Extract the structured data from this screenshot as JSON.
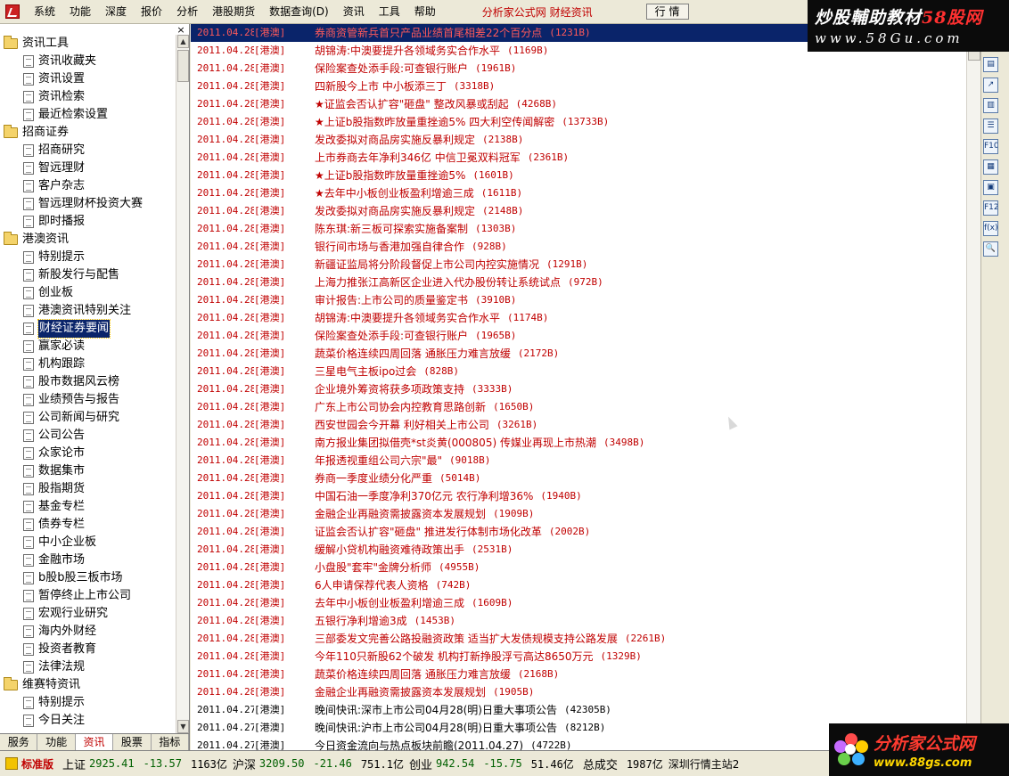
{
  "menubar": {
    "items": [
      "系统",
      "功能",
      "深度",
      "报价",
      "分析",
      "港股期货",
      "数据查询(D)",
      "资讯",
      "工具",
      "帮助"
    ],
    "brand": "分析家公式网 财经资讯",
    "market_button": "行 情"
  },
  "watermark_top": {
    "line1_part1": "炒股輔助教材",
    "line1_part2": "58股网",
    "line2": "www.58Gu.com"
  },
  "sidebar": {
    "close_label": "×",
    "tree": [
      {
        "type": "folder",
        "label": "资讯工具"
      },
      {
        "type": "leaf",
        "label": "资讯收藏夹"
      },
      {
        "type": "leaf",
        "label": "资讯设置"
      },
      {
        "type": "leaf",
        "label": "资讯检索"
      },
      {
        "type": "leaf",
        "label": "最近检索设置"
      },
      {
        "type": "folder",
        "label": "招商证券"
      },
      {
        "type": "leaf",
        "label": "招商研究"
      },
      {
        "type": "leaf",
        "label": "智远理财"
      },
      {
        "type": "leaf",
        "label": "客户杂志"
      },
      {
        "type": "leaf",
        "label": "智远理财杯投资大赛"
      },
      {
        "type": "leaf",
        "label": "即时播报"
      },
      {
        "type": "folder",
        "label": "港澳资讯"
      },
      {
        "type": "leaf",
        "label": "特别提示"
      },
      {
        "type": "leaf",
        "label": "新股发行与配售"
      },
      {
        "type": "leaf",
        "label": "创业板"
      },
      {
        "type": "leaf",
        "label": "港澳资讯特别关注"
      },
      {
        "type": "leaf",
        "label": "财经证券要闻",
        "selected": true
      },
      {
        "type": "leaf",
        "label": "赢家必读"
      },
      {
        "type": "leaf",
        "label": "机构跟踪"
      },
      {
        "type": "leaf",
        "label": "股市数据风云榜"
      },
      {
        "type": "leaf",
        "label": "业绩预告与报告"
      },
      {
        "type": "leaf",
        "label": "公司新闻与研究"
      },
      {
        "type": "leaf",
        "label": "公司公告"
      },
      {
        "type": "leaf",
        "label": "众家论市"
      },
      {
        "type": "leaf",
        "label": "数据集市"
      },
      {
        "type": "leaf",
        "label": "股指期货"
      },
      {
        "type": "leaf",
        "label": "基金专栏"
      },
      {
        "type": "leaf",
        "label": "债券专栏"
      },
      {
        "type": "leaf",
        "label": "中小企业板"
      },
      {
        "type": "leaf",
        "label": "金融市场"
      },
      {
        "type": "leaf",
        "label": "b股b股三板市场"
      },
      {
        "type": "leaf",
        "label": "暂停终止上市公司"
      },
      {
        "type": "leaf",
        "label": "宏观行业研究"
      },
      {
        "type": "leaf",
        "label": "海内外财经"
      },
      {
        "type": "leaf",
        "label": "投资者教育"
      },
      {
        "type": "leaf",
        "label": "法律法规"
      },
      {
        "type": "folder",
        "label": "维赛特资讯"
      },
      {
        "type": "leaf",
        "label": "特别提示"
      },
      {
        "type": "leaf",
        "label": "今日关注"
      }
    ],
    "tabs": [
      {
        "label": "服务",
        "active": false
      },
      {
        "label": "功能",
        "active": false
      },
      {
        "label": "资讯",
        "active": true
      },
      {
        "label": "股票",
        "active": false
      },
      {
        "label": "指标",
        "active": false
      }
    ]
  },
  "news": [
    {
      "date": "2011.04.28",
      "src": "[港澳]",
      "title": "券商资管新兵首只产品业绩首尾相差22个百分点",
      "size": "(1231B)",
      "style": "highlight"
    },
    {
      "date": "2011.04.28",
      "src": "[港澳]",
      "title": "胡锦涛:中澳要提升各领域务实合作水平",
      "size": "(1169B)",
      "style": "red"
    },
    {
      "date": "2011.04.28",
      "src": "[港澳]",
      "title": "保险案查处添手段:可查银行账户",
      "size": "(1961B)",
      "style": "red"
    },
    {
      "date": "2011.04.28",
      "src": "[港澳]",
      "title": "四新股今上市 中小板添三丁",
      "size": "(3318B)",
      "style": "red"
    },
    {
      "date": "2011.04.28",
      "src": "[港澳]",
      "title": "★证监会否认扩容\"砸盘\" 整改风暴或刮起",
      "size": "(4268B)",
      "style": "red"
    },
    {
      "date": "2011.04.28",
      "src": "[港澳]",
      "title": "★上证b股指数昨放量重挫逾5% 四大利空传闻解密",
      "size": "(13733B)",
      "style": "red"
    },
    {
      "date": "2011.04.28",
      "src": "[港澳]",
      "title": "发改委拟对商品房实施反暴利规定",
      "size": "(2138B)",
      "style": "red"
    },
    {
      "date": "2011.04.28",
      "src": "[港澳]",
      "title": "上市券商去年净利346亿 中信卫冕双料冠军",
      "size": "(2361B)",
      "style": "red"
    },
    {
      "date": "2011.04.28",
      "src": "[港澳]",
      "title": "★上证b股指数昨放量重挫逾5%",
      "size": "(1601B)",
      "style": "red"
    },
    {
      "date": "2011.04.28",
      "src": "[港澳]",
      "title": "★去年中小板创业板盈利增逾三成",
      "size": "(1611B)",
      "style": "red"
    },
    {
      "date": "2011.04.28",
      "src": "[港澳]",
      "title": "发改委拟对商品房实施反暴利规定",
      "size": "(2148B)",
      "style": "red"
    },
    {
      "date": "2011.04.28",
      "src": "[港澳]",
      "title": "陈东琪:新三板可探索实施备案制",
      "size": "(1303B)",
      "style": "red"
    },
    {
      "date": "2011.04.28",
      "src": "[港澳]",
      "title": "银行间市场与香港加强自律合作",
      "size": "(928B)",
      "style": "red"
    },
    {
      "date": "2011.04.28",
      "src": "[港澳]",
      "title": "新疆证监局将分阶段督促上市公司内控实施情况",
      "size": "(1291B)",
      "style": "red"
    },
    {
      "date": "2011.04.28",
      "src": "[港澳]",
      "title": "上海力推张江高新区企业进入代办股份转让系统试点",
      "size": "(972B)",
      "style": "red"
    },
    {
      "date": "2011.04.28",
      "src": "[港澳]",
      "title": "审计报告:上市公司的质量鉴定书",
      "size": "(3910B)",
      "style": "red"
    },
    {
      "date": "2011.04.28",
      "src": "[港澳]",
      "title": "胡锦涛:中澳要提升各领域务实合作水平",
      "size": "(1174B)",
      "style": "red"
    },
    {
      "date": "2011.04.28",
      "src": "[港澳]",
      "title": "保险案查处添手段:可查银行账户",
      "size": "(1965B)",
      "style": "red"
    },
    {
      "date": "2011.04.28",
      "src": "[港澳]",
      "title": "蔬菜价格连续四周回落 通胀压力难言放缓",
      "size": "(2172B)",
      "style": "red"
    },
    {
      "date": "2011.04.28",
      "src": "[港澳]",
      "title": "三星电气主板ipo过会",
      "size": "(828B)",
      "style": "red"
    },
    {
      "date": "2011.04.28",
      "src": "[港澳]",
      "title": "企业境外筹资将获多项政策支持",
      "size": "(3333B)",
      "style": "red"
    },
    {
      "date": "2011.04.28",
      "src": "[港澳]",
      "title": "广东上市公司协会内控教育思路创新",
      "size": "(1650B)",
      "style": "red"
    },
    {
      "date": "2011.04.28",
      "src": "[港澳]",
      "title": "西安世园会今开幕 利好相关上市公司",
      "size": "(3261B)",
      "style": "red"
    },
    {
      "date": "2011.04.28",
      "src": "[港澳]",
      "title": "南方报业集团拟借壳*st炎黄(000805) 传媒业再现上市热潮",
      "size": "(3498B)",
      "style": "red"
    },
    {
      "date": "2011.04.28",
      "src": "[港澳]",
      "title": "年报透视重组公司六宗\"最\"",
      "size": "(9018B)",
      "style": "red"
    },
    {
      "date": "2011.04.28",
      "src": "[港澳]",
      "title": "券商一季度业绩分化严重",
      "size": "(5014B)",
      "style": "red"
    },
    {
      "date": "2011.04.28",
      "src": "[港澳]",
      "title": "中国石油一季度净利370亿元 农行净利增36%",
      "size": "(1940B)",
      "style": "red"
    },
    {
      "date": "2011.04.28",
      "src": "[港澳]",
      "title": "金融企业再融资需披露资本发展规划",
      "size": "(1909B)",
      "style": "red"
    },
    {
      "date": "2011.04.28",
      "src": "[港澳]",
      "title": "证监会否认扩容\"砸盘\" 推进发行体制市场化改革",
      "size": "(2002B)",
      "style": "red"
    },
    {
      "date": "2011.04.28",
      "src": "[港澳]",
      "title": "缓解小贷机构融资难待政策出手",
      "size": "(2531B)",
      "style": "red"
    },
    {
      "date": "2011.04.28",
      "src": "[港澳]",
      "title": "小盘股\"套牢\"金牌分析师",
      "size": "(4955B)",
      "style": "red"
    },
    {
      "date": "2011.04.28",
      "src": "[港澳]",
      "title": "6人申请保荐代表人资格",
      "size": "(742B)",
      "style": "red"
    },
    {
      "date": "2011.04.28",
      "src": "[港澳]",
      "title": "去年中小板创业板盈利增逾三成",
      "size": "(1609B)",
      "style": "red"
    },
    {
      "date": "2011.04.28",
      "src": "[港澳]",
      "title": "五银行净利增逾3成",
      "size": "(1453B)",
      "style": "red"
    },
    {
      "date": "2011.04.28",
      "src": "[港澳]",
      "title": "三部委发文完善公路投融资政策 适当扩大发债规模支持公路发展",
      "size": "(2261B)",
      "style": "red"
    },
    {
      "date": "2011.04.28",
      "src": "[港澳]",
      "title": "今年110只新股62个破发 机构打新挣股浮亏高达8650万元",
      "size": "(1329B)",
      "style": "red"
    },
    {
      "date": "2011.04.28",
      "src": "[港澳]",
      "title": "蔬菜价格连续四周回落 通胀压力难言放缓",
      "size": "(2168B)",
      "style": "red"
    },
    {
      "date": "2011.04.28",
      "src": "[港澳]",
      "title": "金融企业再融资需披露资本发展规划",
      "size": "(1905B)",
      "style": "red"
    },
    {
      "date": "2011.04.27",
      "src": "[港澳]",
      "title": "晚间快讯:深市上市公司04月28(明)日重大事项公告",
      "size": "(42305B)",
      "style": "black"
    },
    {
      "date": "2011.04.27",
      "src": "[港澳]",
      "title": "晚间快讯:沪市上市公司04月28(明)日重大事项公告",
      "size": "(8212B)",
      "style": "black"
    },
    {
      "date": "2011.04.27",
      "src": "[港澳]",
      "title": "今日资金流向与热点板块前瞻(2011.04.27)",
      "size": "(4722B)",
      "style": "black"
    }
  ],
  "right_toolbar": [
    "▤",
    "↗",
    "▥",
    "☰",
    "F10",
    "▦",
    "▣",
    "F12",
    "f(x)",
    "🔍"
  ],
  "statusbar": {
    "edition": "标准版",
    "indices": [
      {
        "name": "上证",
        "value": "2925.41",
        "change": "-13.57",
        "amount": "1163亿"
      },
      {
        "name": "沪深",
        "value": "3209.50",
        "change": "-21.46",
        "amount": "751.1亿"
      },
      {
        "name": "创业",
        "value": "942.54",
        "change": "-15.75",
        "amount": "51.46亿"
      }
    ],
    "total_label": "总成交",
    "total_value": "1987亿",
    "server": "深圳行情主站2"
  },
  "watermark_bottom": {
    "line1": "分析家公式网",
    "line2": "www.88gs.com"
  },
  "colors": {
    "news_red": "#c00000",
    "highlight_bg": "#0a246a",
    "index_green": "#006000"
  }
}
